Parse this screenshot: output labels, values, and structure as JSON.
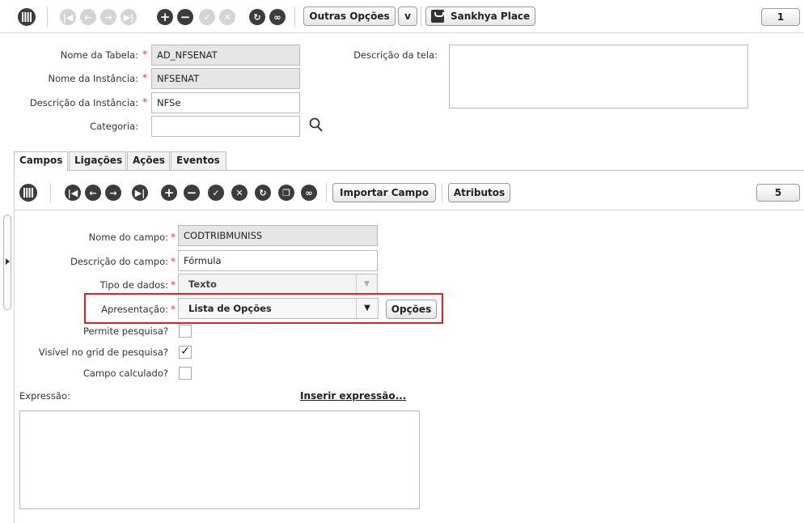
{
  "top_toolbar": {
    "outras_opcoes": "Outras Opções",
    "dropdown_arrow": "v",
    "sankhya_place": "Sankhya Place",
    "page_number": "1"
  },
  "header_form": {
    "nome_tabela_label": "Nome da Tabela:",
    "nome_tabela_value": "AD_NFSENAT",
    "nome_instancia_label": "Nome da Instância:",
    "nome_instancia_value": "NFSENAT",
    "descricao_instancia_label": "Descrição da Instância:",
    "descricao_instancia_value": "NFSe",
    "categoria_label": "Categoria:",
    "categoria_value": "",
    "descricao_tela_label": "Descrição da tela:",
    "descricao_tela_value": ""
  },
  "tabs": [
    "Campos",
    "Ligações",
    "Ações",
    "Eventos"
  ],
  "inner_toolbar": {
    "importar_campo": "Importar Campo",
    "atributos": "Atributos",
    "page_number": "5"
  },
  "field_form": {
    "nome_campo_label": "Nome do campo:",
    "nome_campo_value": "CODTRIBMUNISS",
    "descricao_campo_label": "Descrição do campo:",
    "descricao_campo_value": "Fórmula",
    "tipo_dados_label": "Tipo de dados:",
    "tipo_dados_value": "Texto",
    "apresentacao_label": "Apresentação:",
    "apresentacao_value": "Lista de Opções",
    "opcoes_button": "Opções",
    "permite_pesquisa_label": "Permite pesquisa?",
    "permite_pesquisa_checked": false,
    "visivel_grid_label": "Visível no grid de pesquisa?",
    "visivel_grid_checked": true,
    "campo_calculado_label": "Campo calculado?",
    "campo_calculado_checked": false,
    "expressao_label": "Expressão:",
    "inserir_expressao_link": "Inserir expressão...",
    "expressao_value": ""
  },
  "required_marker": "*",
  "highlight_color": "#e02020"
}
